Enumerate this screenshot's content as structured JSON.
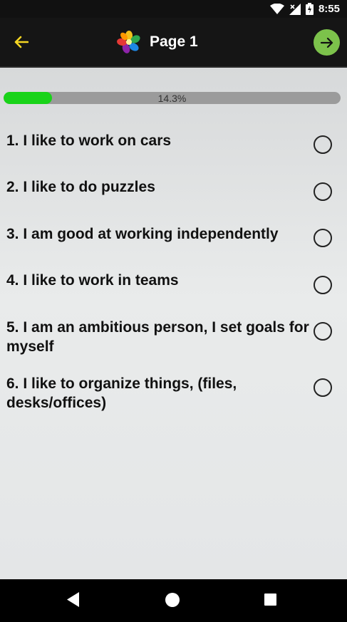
{
  "status_bar": {
    "time": "8:55",
    "icons": [
      "wifi-icon",
      "signal-icon",
      "battery-icon"
    ]
  },
  "app_bar": {
    "title": "Page 1",
    "back_icon": "arrow-left-icon",
    "next_icon": "arrow-right-icon",
    "logo_icon": "flower-logo-icon",
    "back_color": "#f5d623",
    "next_button_color": "#7cc24b"
  },
  "progress": {
    "label": "14.3%",
    "value": 0.143,
    "fill_color": "#19d319",
    "track_color": "#9b9b9b"
  },
  "questions": [
    {
      "text": "1. I like to work on cars",
      "selected": false
    },
    {
      "text": "2. I like to do puzzles",
      "selected": false
    },
    {
      "text": "3. I am good at working independently",
      "selected": false
    },
    {
      "text": "4. I like to work in teams",
      "selected": false
    },
    {
      "text": "5. I am an ambitious person, I set goals for myself",
      "selected": false
    },
    {
      "text": "6. I like to organize things, (files, desks/offices)",
      "selected": false
    }
  ],
  "nav_bar": {
    "icons": [
      "nav-back-icon",
      "nav-home-icon",
      "nav-recent-icon"
    ]
  }
}
